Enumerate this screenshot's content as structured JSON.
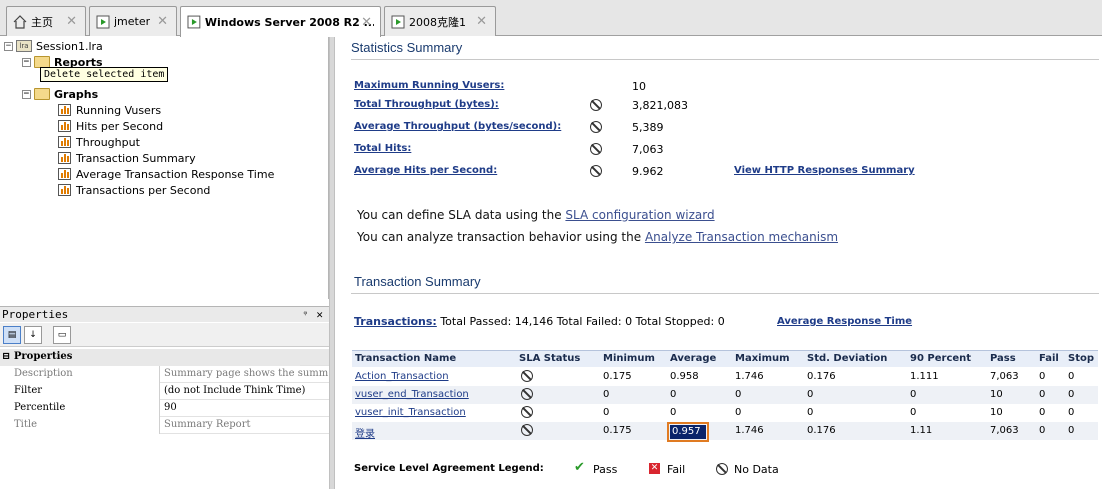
{
  "tabs": [
    {
      "label": "主页",
      "icon": "home-icon"
    },
    {
      "label": "jmeter",
      "icon": "vm-play-icon"
    },
    {
      "label": "Windows Server 2008 R2 ...",
      "icon": "vm-play-icon"
    },
    {
      "label": "2008克隆1",
      "icon": "vm-play-icon"
    }
  ],
  "tree": {
    "root": "Session1.lra",
    "reports": "Reports",
    "tooltip": "Delete selected item",
    "graphs": "Graphs",
    "items": [
      "Running Vusers",
      "Hits per Second",
      "Throughput",
      "Transaction Summary",
      "Average Transaction Response Time",
      "Transactions per Second"
    ]
  },
  "properties": {
    "title": "Properties",
    "pin": "ᵠ",
    "close": "✕",
    "category": "Properties",
    "rows": [
      {
        "key": "Description",
        "value": "Summary page shows the summ"
      },
      {
        "key": "Filter",
        "value": "(do not Include Think Time)"
      },
      {
        "key": "Percentile",
        "value": "90"
      },
      {
        "key": "Title",
        "value": "Summary Report"
      }
    ]
  },
  "stats": {
    "title": "Statistics Summary",
    "rows": [
      {
        "label": "Maximum Running Vusers:",
        "value": "10"
      },
      {
        "label": "Total Throughput (bytes):",
        "value": "3,821,083"
      },
      {
        "label": "Average Throughput (bytes/second):",
        "value": "5,389"
      },
      {
        "label": "Total Hits:",
        "value": "7,063"
      },
      {
        "label": "Average Hits per Second:",
        "value": "9.962"
      }
    ],
    "http_link": "View HTTP Responses Summary"
  },
  "sla": {
    "line1_prefix": "You can define SLA data using the ",
    "line1_link": "SLA configuration wizard",
    "line2_prefix": "You can analyze transaction behavior using the ",
    "line2_link": "Analyze Transaction mechanism"
  },
  "transactions": {
    "title": "Transaction Summary",
    "link": "Transactions:",
    "summary": "Total Passed: 14,146 Total Failed: 0 Total Stopped: 0",
    "avg_link": "Average Response Time",
    "headers": [
      "Transaction Name",
      "SLA Status",
      "Minimum",
      "Average",
      "Maximum",
      "Std. Deviation",
      "90 Percent",
      "Pass",
      "Fail",
      "Stop"
    ],
    "rows": [
      [
        "Action_Transaction",
        "",
        "0.175",
        "0.958",
        "1.746",
        "0.176",
        "1.111",
        "7,063",
        "0",
        "0"
      ],
      [
        "vuser_end_Transaction",
        "",
        "0",
        "0",
        "0",
        "0",
        "0",
        "10",
        "0",
        "0"
      ],
      [
        "vuser_init_Transaction",
        "",
        "0",
        "0",
        "0",
        "0",
        "0",
        "10",
        "0",
        "0"
      ],
      [
        "登录",
        "",
        "0.175",
        "0.957",
        "1.746",
        "0.176",
        "1.11",
        "7,063",
        "0",
        "0"
      ]
    ]
  },
  "legend": {
    "title": "Service Level Agreement Legend:",
    "pass": "Pass",
    "fail": "Fail",
    "nodata": "No Data"
  }
}
